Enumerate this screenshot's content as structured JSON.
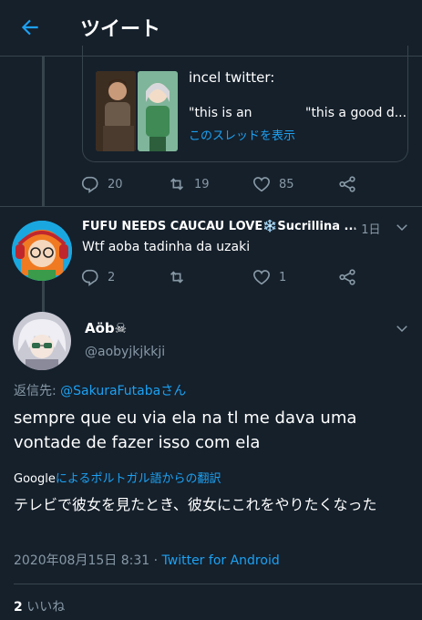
{
  "header": {
    "title": "ツイート"
  },
  "quoted_tweet": {
    "label": "incel twitter:",
    "col1": "\"this is an",
    "col2": "\"this a good d...",
    "thread_link": "このスレッドを表示"
  },
  "tweet1_actions": {
    "replies": "20",
    "retweets": "19",
    "likes": "85"
  },
  "tweet2": {
    "name": "FUFU NEEDS CAUCAU LOVE❄️Sucrillina ...",
    "time": "· 1日",
    "text": "Wtf aoba tadinha da uzaki",
    "replies": "2",
    "retweets": "",
    "likes": "1"
  },
  "main_tweet": {
    "name": "Aöb☠",
    "handle": "@aobyjkjkkji",
    "reply_prefix": "返信先: ",
    "reply_to": "@SakuraFutabaさん",
    "body": "sempre que eu via ela na tl me dava uma vontade de fazer isso com ela",
    "google_label": "Google",
    "translate_label": "によるポルトガル語からの翻訳",
    "translation": "テレビで彼女を見たとき、彼女にこれをやりたくなった",
    "datetime": "2020年08月15日 8:31",
    "separator": " · ",
    "client": "Twitter for Android",
    "likes_count": "2",
    "likes_label": "いいね"
  },
  "colors": {
    "background": "#15202b",
    "accent": "#1da1f2",
    "muted": "#8899a6",
    "border": "#38444d"
  },
  "icons": [
    "back-arrow-icon",
    "reply-icon",
    "retweet-icon",
    "like-icon",
    "share-icon",
    "chevron-down-icon"
  ]
}
